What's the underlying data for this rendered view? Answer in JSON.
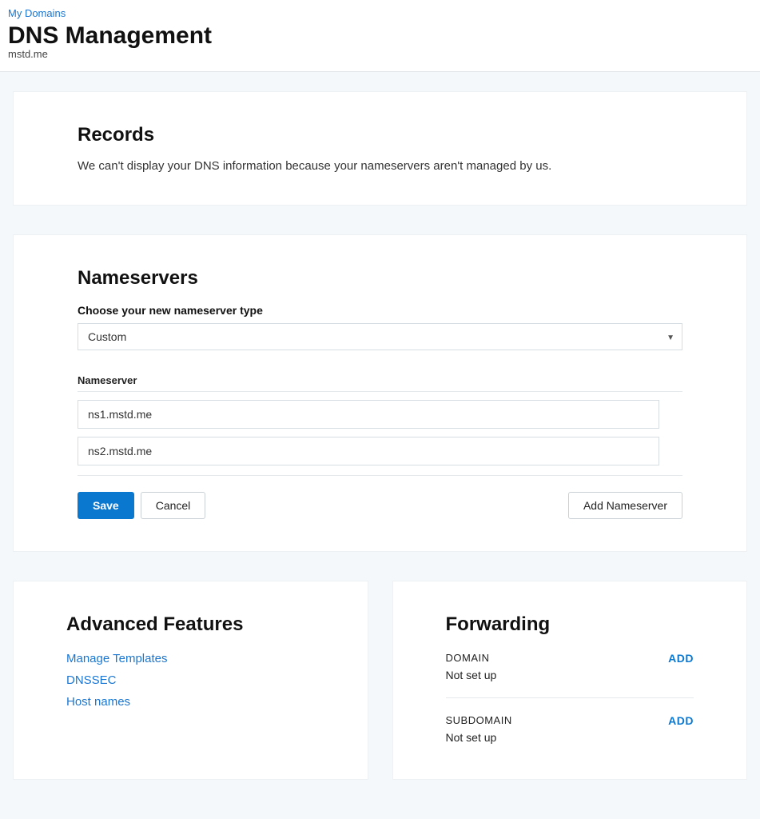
{
  "breadcrumb": "My Domains",
  "page_title": "DNS Management",
  "domain": "mstd.me",
  "records": {
    "heading": "Records",
    "message": "We can't display your DNS information because your nameservers aren't managed by us."
  },
  "nameservers": {
    "heading": "Nameservers",
    "choose_label": "Choose your new nameserver type",
    "type_selected": "Custom",
    "column_header": "Nameserver",
    "entries": [
      "ns1.mstd.me",
      "ns2.mstd.me"
    ],
    "save_label": "Save",
    "cancel_label": "Cancel",
    "add_label": "Add Nameserver"
  },
  "advanced": {
    "heading": "Advanced Features",
    "links": [
      "Manage Templates",
      "DNSSEC",
      "Host names"
    ]
  },
  "forwarding": {
    "heading": "Forwarding",
    "add_label": "ADD",
    "items": [
      {
        "label": "DOMAIN",
        "status": "Not set up"
      },
      {
        "label": "SUBDOMAIN",
        "status": "Not set up"
      }
    ]
  }
}
